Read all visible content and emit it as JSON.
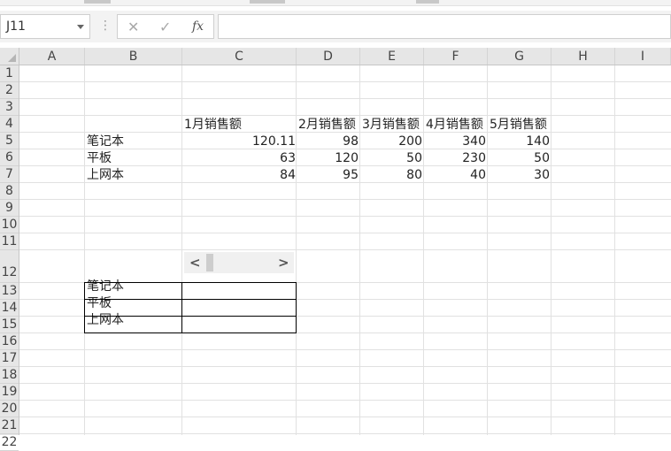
{
  "formula_bar": {
    "name_box": "J11",
    "dots": "⋮",
    "cancel_icon": "✕",
    "confirm_icon": "✓",
    "fx_label": "fx",
    "formula_value": ""
  },
  "columns": [
    "A",
    "B",
    "C",
    "D",
    "E",
    "F",
    "G",
    "H",
    "I"
  ],
  "rows": [
    "1",
    "2",
    "3",
    "4",
    "5",
    "6",
    "7",
    "8",
    "9",
    "10",
    "11",
    "12",
    "13",
    "14",
    "15",
    "16",
    "17",
    "18",
    "19",
    "20",
    "21",
    "22"
  ],
  "headers": {
    "c4": "1月销售额",
    "d4": "2月销售额",
    "e4": "3月销售额",
    "f4": "4月销售额",
    "g4": "5月销售额"
  },
  "data_rows": [
    {
      "label": "笔记本",
      "c": "120.11",
      "d": "98",
      "e": "200",
      "f": "340",
      "g": "140"
    },
    {
      "label": "平板",
      "c": "63",
      "d": "120",
      "e": "50",
      "f": "230",
      "g": "50"
    },
    {
      "label": "上网本",
      "c": "84",
      "d": "95",
      "e": "80",
      "f": "40",
      "g": "30"
    }
  ],
  "lookup_rows": [
    {
      "label": "笔记本",
      "value": ""
    },
    {
      "label": "平板",
      "value": ""
    },
    {
      "label": "上网本",
      "value": ""
    }
  ],
  "scroll_control": {
    "left": "<",
    "right": ">"
  }
}
